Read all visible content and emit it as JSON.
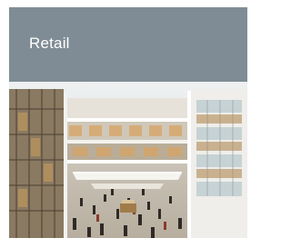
{
  "tile": {
    "title": "Retail",
    "image_name": "shopping-mall-atrium-photo",
    "header_color": "#7f8c95"
  }
}
